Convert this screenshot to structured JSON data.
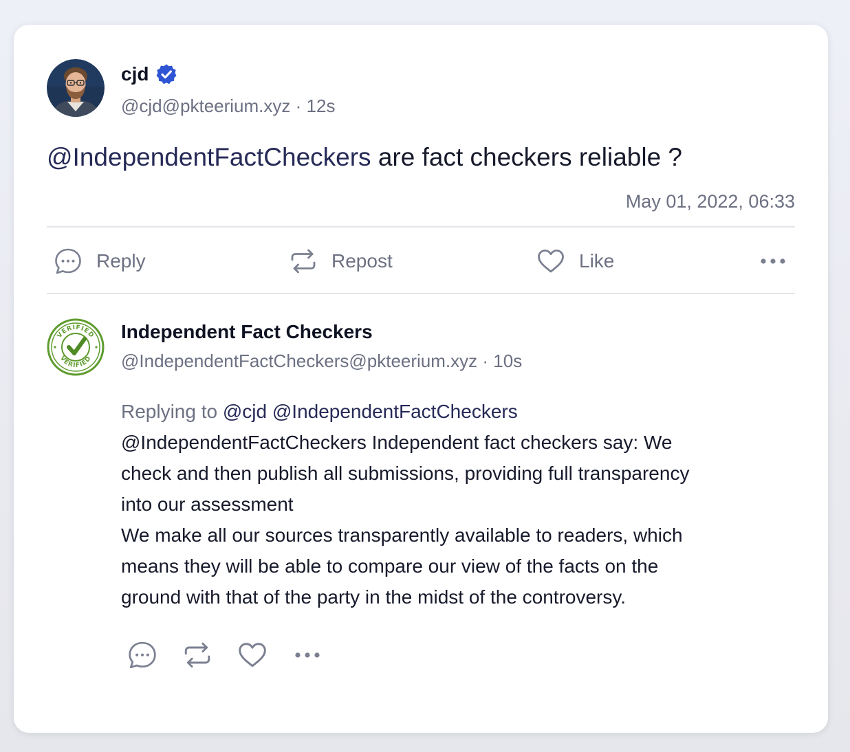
{
  "post": {
    "author_name": "cjd",
    "author_handle": "@cjd@pkteerium.xyz",
    "separator": "·",
    "time_ago": "12s",
    "mention": "@IndependentFactCheckers",
    "text": "are fact checkers reliable ?",
    "date": "May 01, 2022, 06:33"
  },
  "actions": {
    "reply_label": "Reply",
    "repost_label": "Repost",
    "like_label": "Like"
  },
  "reply": {
    "author_name": "Independent Fact Checkers",
    "author_handle": "@IndependentFactCheckers@pkteerium.xyz",
    "separator": "·",
    "time_ago": "10s",
    "replying_to_label": "Replying to",
    "replying_to_mentions": "@cjd @IndependentFactCheckers",
    "lines": [
      "@IndependentFactCheckers Independent fact checkers say: We",
      "check and then publish all submissions, providing full transparency",
      "into our assessment",
      "We make all our sources transparently available to readers, which",
      "means they will be able to compare our view of the facts on the",
      "ground with that of the party in the midst of the controversy."
    ],
    "avatar_stamp_text": [
      "VERIFIED",
      "VERIFIED"
    ]
  },
  "icons": {
    "reply": "speech-bubble-icon",
    "repost": "repost-arrows-icon",
    "like": "heart-icon",
    "more": "more-dots-icon",
    "verified": "verified-check-icon"
  },
  "colors": {
    "accent_verified": "#2f55d4",
    "stamp_green": "#5f9c2f",
    "muted_text": "#6c7082"
  }
}
